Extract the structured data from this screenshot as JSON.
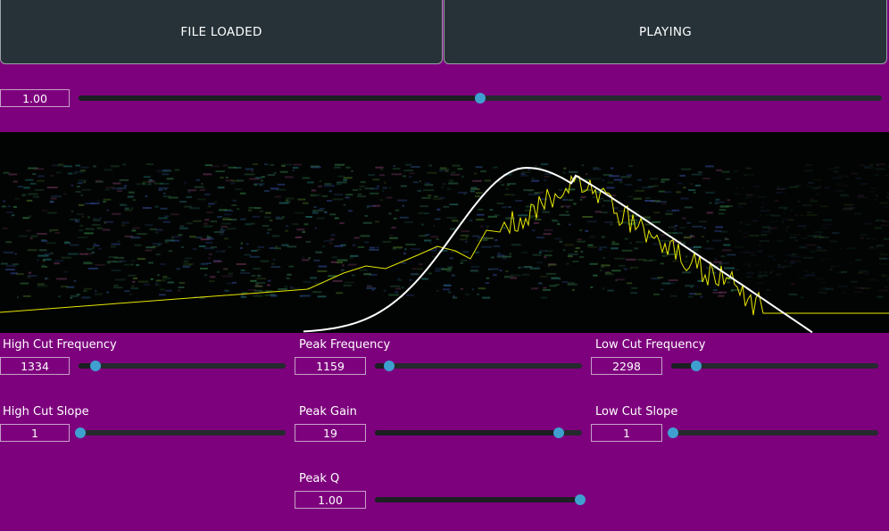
{
  "transport": {
    "file_button_label": "FILE LOADED",
    "play_button_label": "PLAYING"
  },
  "gain": {
    "value": "1.00",
    "fraction": 0.5
  },
  "colors": {
    "background": "#7d007d",
    "button_bg": "#263238",
    "slider_thumb": "#3fa0d0",
    "filter_curve": "#ffffff",
    "spectrum_line": "#e8e800"
  },
  "controls": {
    "high_cut_freq": {
      "label": "High Cut Frequency",
      "value": "1334",
      "fraction": 0.08
    },
    "peak_freq": {
      "label": "Peak Frequency",
      "value": "1159",
      "fraction": 0.07
    },
    "low_cut_freq": {
      "label": "Low Cut Frequency",
      "value": "2298",
      "fraction": 0.12
    },
    "high_cut_slope": {
      "label": "High Cut Slope",
      "value": "1",
      "fraction": 0.0
    },
    "peak_gain": {
      "label": "Peak Gain",
      "value": "19",
      "fraction": 0.89
    },
    "low_cut_slope": {
      "label": "Low Cut Slope",
      "value": "1",
      "fraction": 0.0
    },
    "peak_q": {
      "label": "Peak Q",
      "value": "1.00",
      "fraction": 1.0
    }
  }
}
